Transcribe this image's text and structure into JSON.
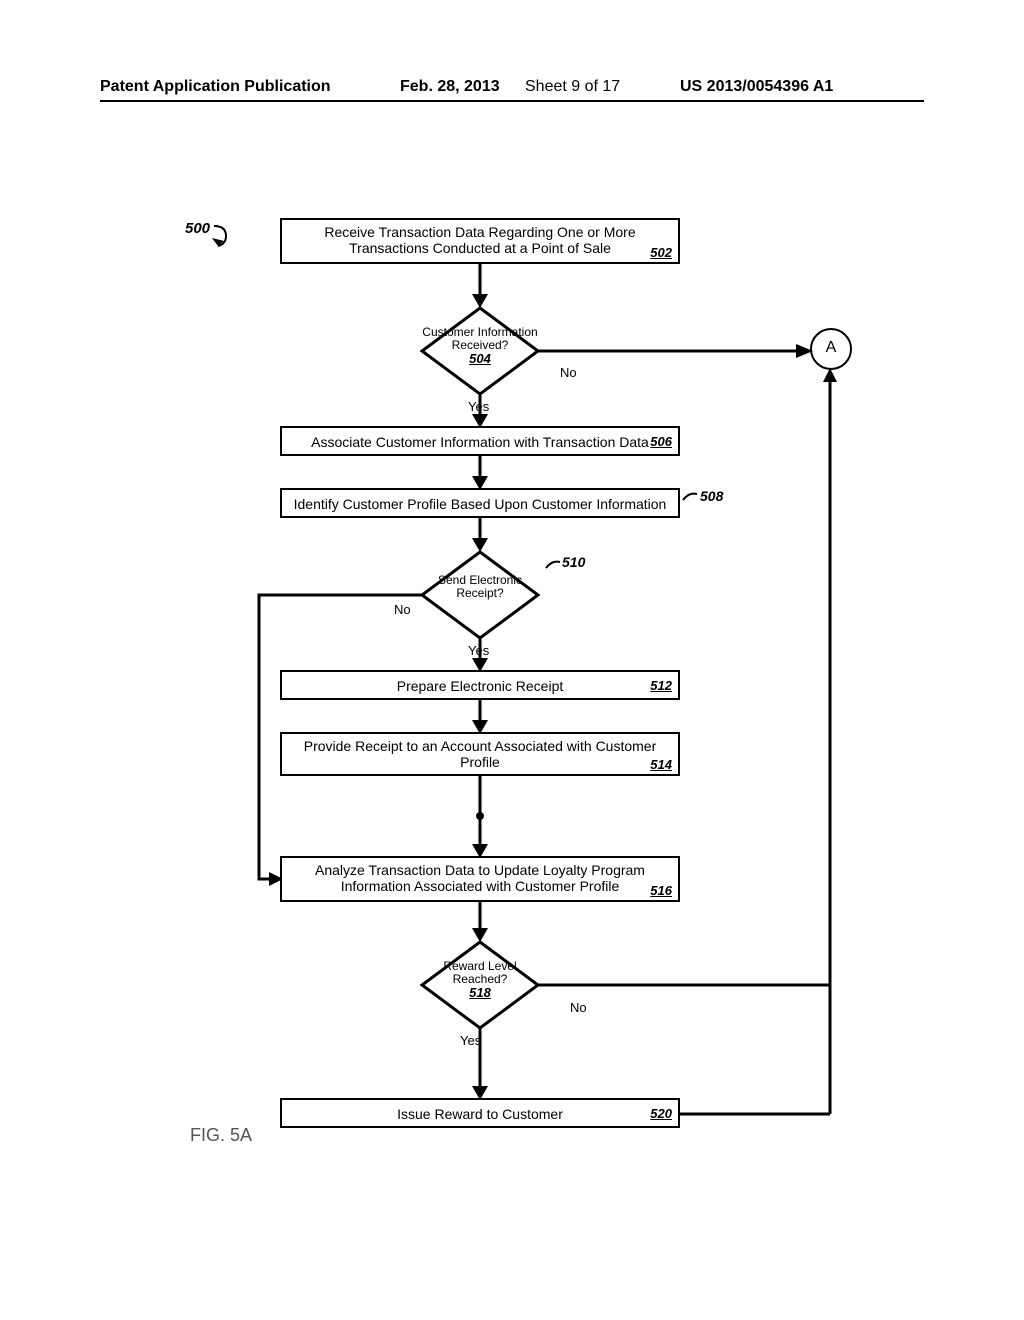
{
  "header": {
    "left": "Patent Application Publication",
    "date": "Feb. 28, 2013",
    "sheet": "Sheet 9 of 17",
    "pubnum": "US 2013/0054396 A1"
  },
  "figure_label": "FIG. 5A",
  "ref_start": "500",
  "connector": "A",
  "steps": {
    "s502": {
      "text": "Receive Transaction Data Regarding One or More Transactions Conducted at a Point of Sale",
      "ref": "502"
    },
    "s504": {
      "text": "Customer Information Received?",
      "ref": "504",
      "yes": "Yes",
      "no": "No"
    },
    "s506": {
      "text": "Associate Customer Information with Transaction Data",
      "ref": "506"
    },
    "s508": {
      "text": "Identify Customer Profile Based Upon Customer Information",
      "ref": "508"
    },
    "s510": {
      "text": "Send Electronic Receipt?",
      "ref": "510",
      "yes": "Yes",
      "no": "No"
    },
    "s512": {
      "text": "Prepare Electronic Receipt",
      "ref": "512"
    },
    "s514": {
      "text": "Provide Receipt to an Account Associated with Customer Profile",
      "ref": "514"
    },
    "s516": {
      "text": "Analyze Transaction Data to Update Loyalty Program Information Associated with Customer Profile",
      "ref": "516"
    },
    "s518": {
      "text": "Reward Level Reached?",
      "ref": "518",
      "yes": "Yes",
      "no": "No"
    },
    "s520": {
      "text": "Issue Reward to Customer",
      "ref": "520"
    }
  }
}
